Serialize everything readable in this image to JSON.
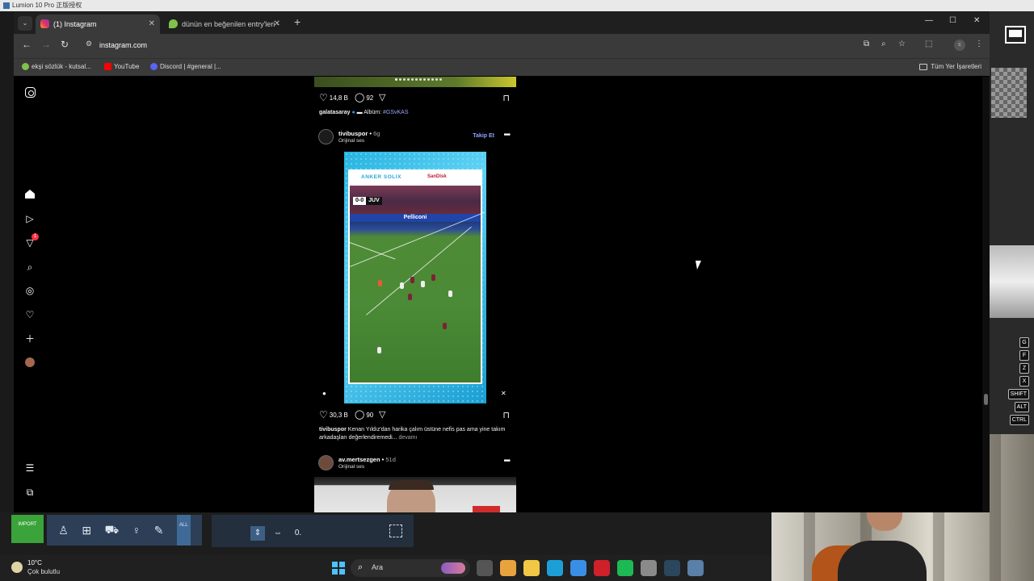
{
  "background_app": {
    "title": "Lumion 10 Pro 正版授权",
    "keys": [
      "G",
      "F",
      "Z",
      "X",
      "SHIFT",
      "ALT",
      "CTRL"
    ],
    "import_label": "IMPORT",
    "all_label": "ALL",
    "tool_value": "0."
  },
  "browser": {
    "tabs": [
      {
        "label": "(1) Instagram",
        "active": true
      },
      {
        "label": "dünün en beğenilen entry'leri -",
        "active": false
      }
    ],
    "url": "instagram.com",
    "bookmarks": [
      {
        "label": "ekşi sözlük - kutsal...",
        "color": "#81c14b"
      },
      {
        "label": "YouTube",
        "color": "#ff0000"
      },
      {
        "label": "Discord | #general |...",
        "color": "#5865f2"
      }
    ],
    "all_bookmarks": "Tüm Yer İşaretleri",
    "profile_initial": "c"
  },
  "instagram": {
    "sidebar": {
      "notification_count": "1"
    },
    "previous_post": {
      "likes": "14,8 B",
      "comments": "92",
      "caption_user": "galatasaray",
      "caption_text": "Albüm:",
      "caption_tag": "#GSvKAS"
    },
    "reel_post": {
      "username": "tivibuspor",
      "time": "6g",
      "audio": "Orijinal ses",
      "follow": "Takip Et",
      "sponsor_left": "ANKER SOLIX",
      "sponsor_right": "SanDisk",
      "score": "0-0",
      "team": "JUV",
      "adboard": "Pelliconi",
      "likes": "30,3 B",
      "comments": "90",
      "caption_user": "tivibuspor",
      "caption_text": "Kenan Yıldız'dan harika çalım üstüne nefis pas ama yine takım arkadaşları değerlendiremedi...",
      "more": "devamı"
    },
    "next_post": {
      "username": "av.mertsezgen",
      "time": "51d",
      "audio": "Orijinal ses"
    }
  },
  "taskbar": {
    "temperature": "10°C",
    "weather": "Çok bulutlu",
    "search_placeholder": "Ara",
    "pinned_icons": [
      {
        "name": "chrome-icon",
        "color": "#e8a33d"
      },
      {
        "name": "file-explorer-icon",
        "color": "#f2c744"
      },
      {
        "name": "edge-icon",
        "color": "#1c9fd6"
      },
      {
        "name": "mail-icon",
        "color": "#3a8ee6"
      },
      {
        "name": "opera-icon",
        "color": "#d0202a"
      },
      {
        "name": "spotify-icon",
        "color": "#1db954"
      },
      {
        "name": "settings-icon",
        "color": "#8a8a8a"
      },
      {
        "name": "steam-icon",
        "color": "#2a475e"
      },
      {
        "name": "lumion-icon",
        "color": "#5a7fa8"
      }
    ]
  }
}
